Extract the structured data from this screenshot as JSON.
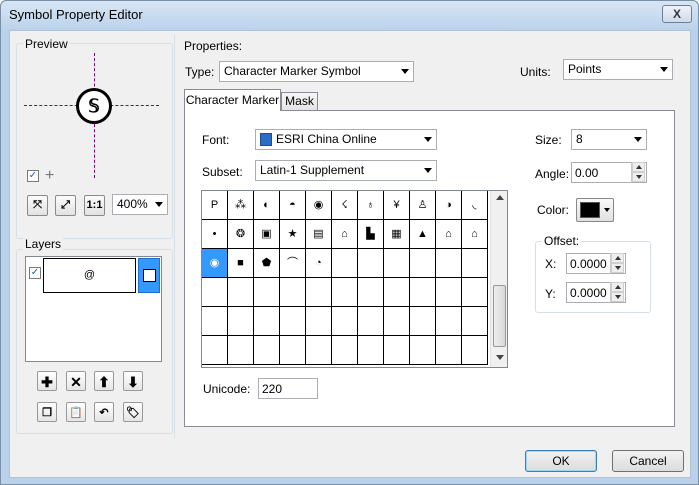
{
  "window": {
    "title": "Symbol Property Editor",
    "close_glyph": "X"
  },
  "preview": {
    "label": "Preview",
    "zoom": "400%",
    "glyph": "𝕊",
    "fit_glyph": "1:1"
  },
  "layers": {
    "label": "Layers",
    "item_glyph": "@"
  },
  "properties": {
    "label": "Properties:",
    "type_label": "Type:",
    "type_value": "Character Marker Symbol",
    "units_label": "Units:",
    "units_value": "Points"
  },
  "tabs": [
    {
      "label": "Character Marker"
    },
    {
      "label": "Mask"
    }
  ],
  "charmarker": {
    "font_label": "Font:",
    "font_value": "ESRI China Online",
    "subset_label": "Subset:",
    "subset_value": "Latin-1 Supplement",
    "unicode_label": "Unicode:",
    "unicode_value": "220",
    "size_label": "Size:",
    "size_value": "8",
    "angle_label": "Angle:",
    "angle_value": "0.00",
    "color_label": "Color:",
    "color_value": "#000000",
    "offset_label": "Offset:",
    "x_label": "X:",
    "x_value": "0.0000",
    "y_label": "Y:",
    "y_value": "0.0000"
  },
  "grid": {
    "rows": [
      [
        "P",
        "⁂",
        "◐",
        "◓",
        "◉",
        "☇",
        "♁",
        "¥",
        "♙",
        "◑",
        "◟"
      ],
      [
        "•",
        "❂",
        "▣",
        "★",
        "▤",
        "⌂",
        "▙",
        "▦",
        "▲",
        "⌂",
        "⌂"
      ],
      [
        "◉",
        "■",
        "⬟",
        "⌒",
        "◔",
        "",
        "",
        "",
        "",
        "",
        ""
      ],
      [
        "",
        "",
        "",
        "",
        "",
        "",
        "",
        "",
        "",
        "",
        ""
      ],
      [
        "",
        "",
        "",
        "",
        "",
        "",
        "",
        "",
        "",
        "",
        ""
      ],
      [
        "",
        "",
        "",
        "",
        "",
        "",
        "",
        "",
        "",
        "",
        ""
      ]
    ],
    "selected_row": 2,
    "selected_col": 0
  },
  "buttons": {
    "ok": "OK",
    "cancel": "Cancel"
  }
}
